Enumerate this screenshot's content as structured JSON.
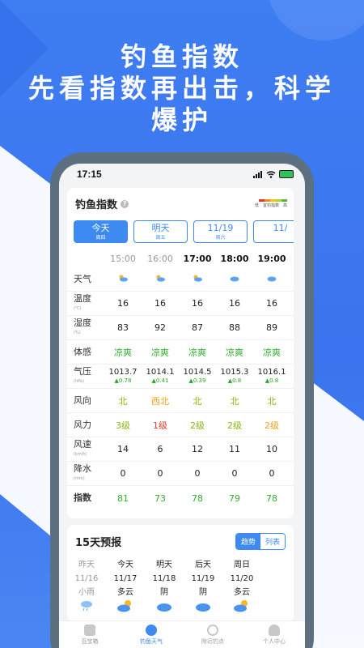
{
  "hero": {
    "line1": "钓鱼指数",
    "line2": "先看指数再出击，科学",
    "line3": "爆护"
  },
  "status": {
    "time": "17:15"
  },
  "card": {
    "title": "钓鱼指数",
    "legend": [
      "低",
      "宜钓指数",
      "高"
    ]
  },
  "days": [
    {
      "label": "今天",
      "sub": "周四",
      "active": true
    },
    {
      "label": "明天",
      "sub": "周五",
      "active": false
    },
    {
      "label": "11/19",
      "sub": "周六",
      "active": false
    },
    {
      "label": "11/",
      "sub": "",
      "active": false
    }
  ],
  "table": {
    "times": [
      "15:00",
      "16:00",
      "17:00",
      "18:00",
      "19:00"
    ],
    "rows": {
      "weather": {
        "label": "天气"
      },
      "temp": {
        "label": "温度",
        "unit": "(℃)",
        "values": [
          "16",
          "16",
          "16",
          "16",
          "16"
        ]
      },
      "humidity": {
        "label": "湿度",
        "unit": "(%)",
        "values": [
          "83",
          "92",
          "87",
          "88",
          "89"
        ]
      },
      "feel": {
        "label": "体感",
        "values": [
          "凉爽",
          "凉爽",
          "凉爽",
          "凉爽",
          "凉爽"
        ]
      },
      "pressure": {
        "label": "气压",
        "unit": "(hPa)",
        "values": [
          "1013.7",
          "1014.1",
          "1014.5",
          "1015.3",
          "1016.1"
        ],
        "changes": [
          "▲0.78",
          "▲0.41",
          "▲0.39",
          "▲0.8",
          "▲0.8"
        ]
      },
      "wind_dir": {
        "label": "风向",
        "values": [
          "北",
          "西北",
          "北",
          "北",
          "北"
        ]
      },
      "wind_force": {
        "label": "风力",
        "values": [
          "3级",
          "1级",
          "2级",
          "2级",
          "2级"
        ]
      },
      "wind_speed": {
        "label": "风速",
        "unit": "(km/h)",
        "values": [
          "14",
          "6",
          "12",
          "11",
          "10"
        ]
      },
      "rain": {
        "label": "降水",
        "unit": "(mm)",
        "values": [
          "0",
          "0",
          "0",
          "0",
          "0"
        ]
      },
      "index": {
        "label": "指数",
        "values": [
          "81",
          "73",
          "78",
          "79",
          "78"
        ]
      }
    }
  },
  "forecast": {
    "title": "15天预报",
    "toggle": [
      "趋势",
      "列表"
    ],
    "days": [
      {
        "name": "昨天",
        "date": "11/16",
        "weather": "小雨"
      },
      {
        "name": "今天",
        "date": "11/17",
        "weather": "多云"
      },
      {
        "name": "明天",
        "date": "11/18",
        "weather": "阴"
      },
      {
        "name": "后天",
        "date": "11/19",
        "weather": "阴"
      },
      {
        "name": "周日",
        "date": "11/20",
        "weather": "多云"
      }
    ]
  },
  "tabs": [
    "百宝箱",
    "钓鱼天气",
    "附近钓点",
    "个人中心"
  ],
  "colors": {
    "accent": "#3d8bf1",
    "hero_bg": "#3f7df2"
  }
}
